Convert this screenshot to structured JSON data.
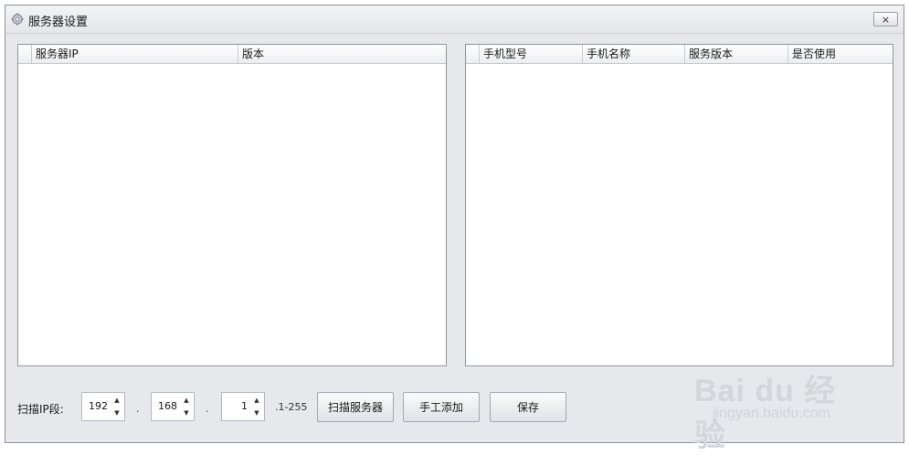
{
  "window": {
    "title": "服务器设置",
    "close_label": "×"
  },
  "left_grid": {
    "columns": [
      "服务器IP",
      "版本"
    ]
  },
  "right_grid": {
    "columns": [
      "手机型号",
      "手机名称",
      "服务版本",
      "是否使用"
    ]
  },
  "bottom": {
    "scan_label": "扫描IP段:",
    "ip1": "192",
    "ip2": "168",
    "ip3": "1",
    "dot": ".",
    "range_suffix": ".1-255",
    "scan_button": "扫描服务器",
    "manual_add_button": "手工添加",
    "save_button": "保存"
  },
  "watermark": {
    "main": "Bai du 经验",
    "sub": "jingyan.baidu.com"
  }
}
